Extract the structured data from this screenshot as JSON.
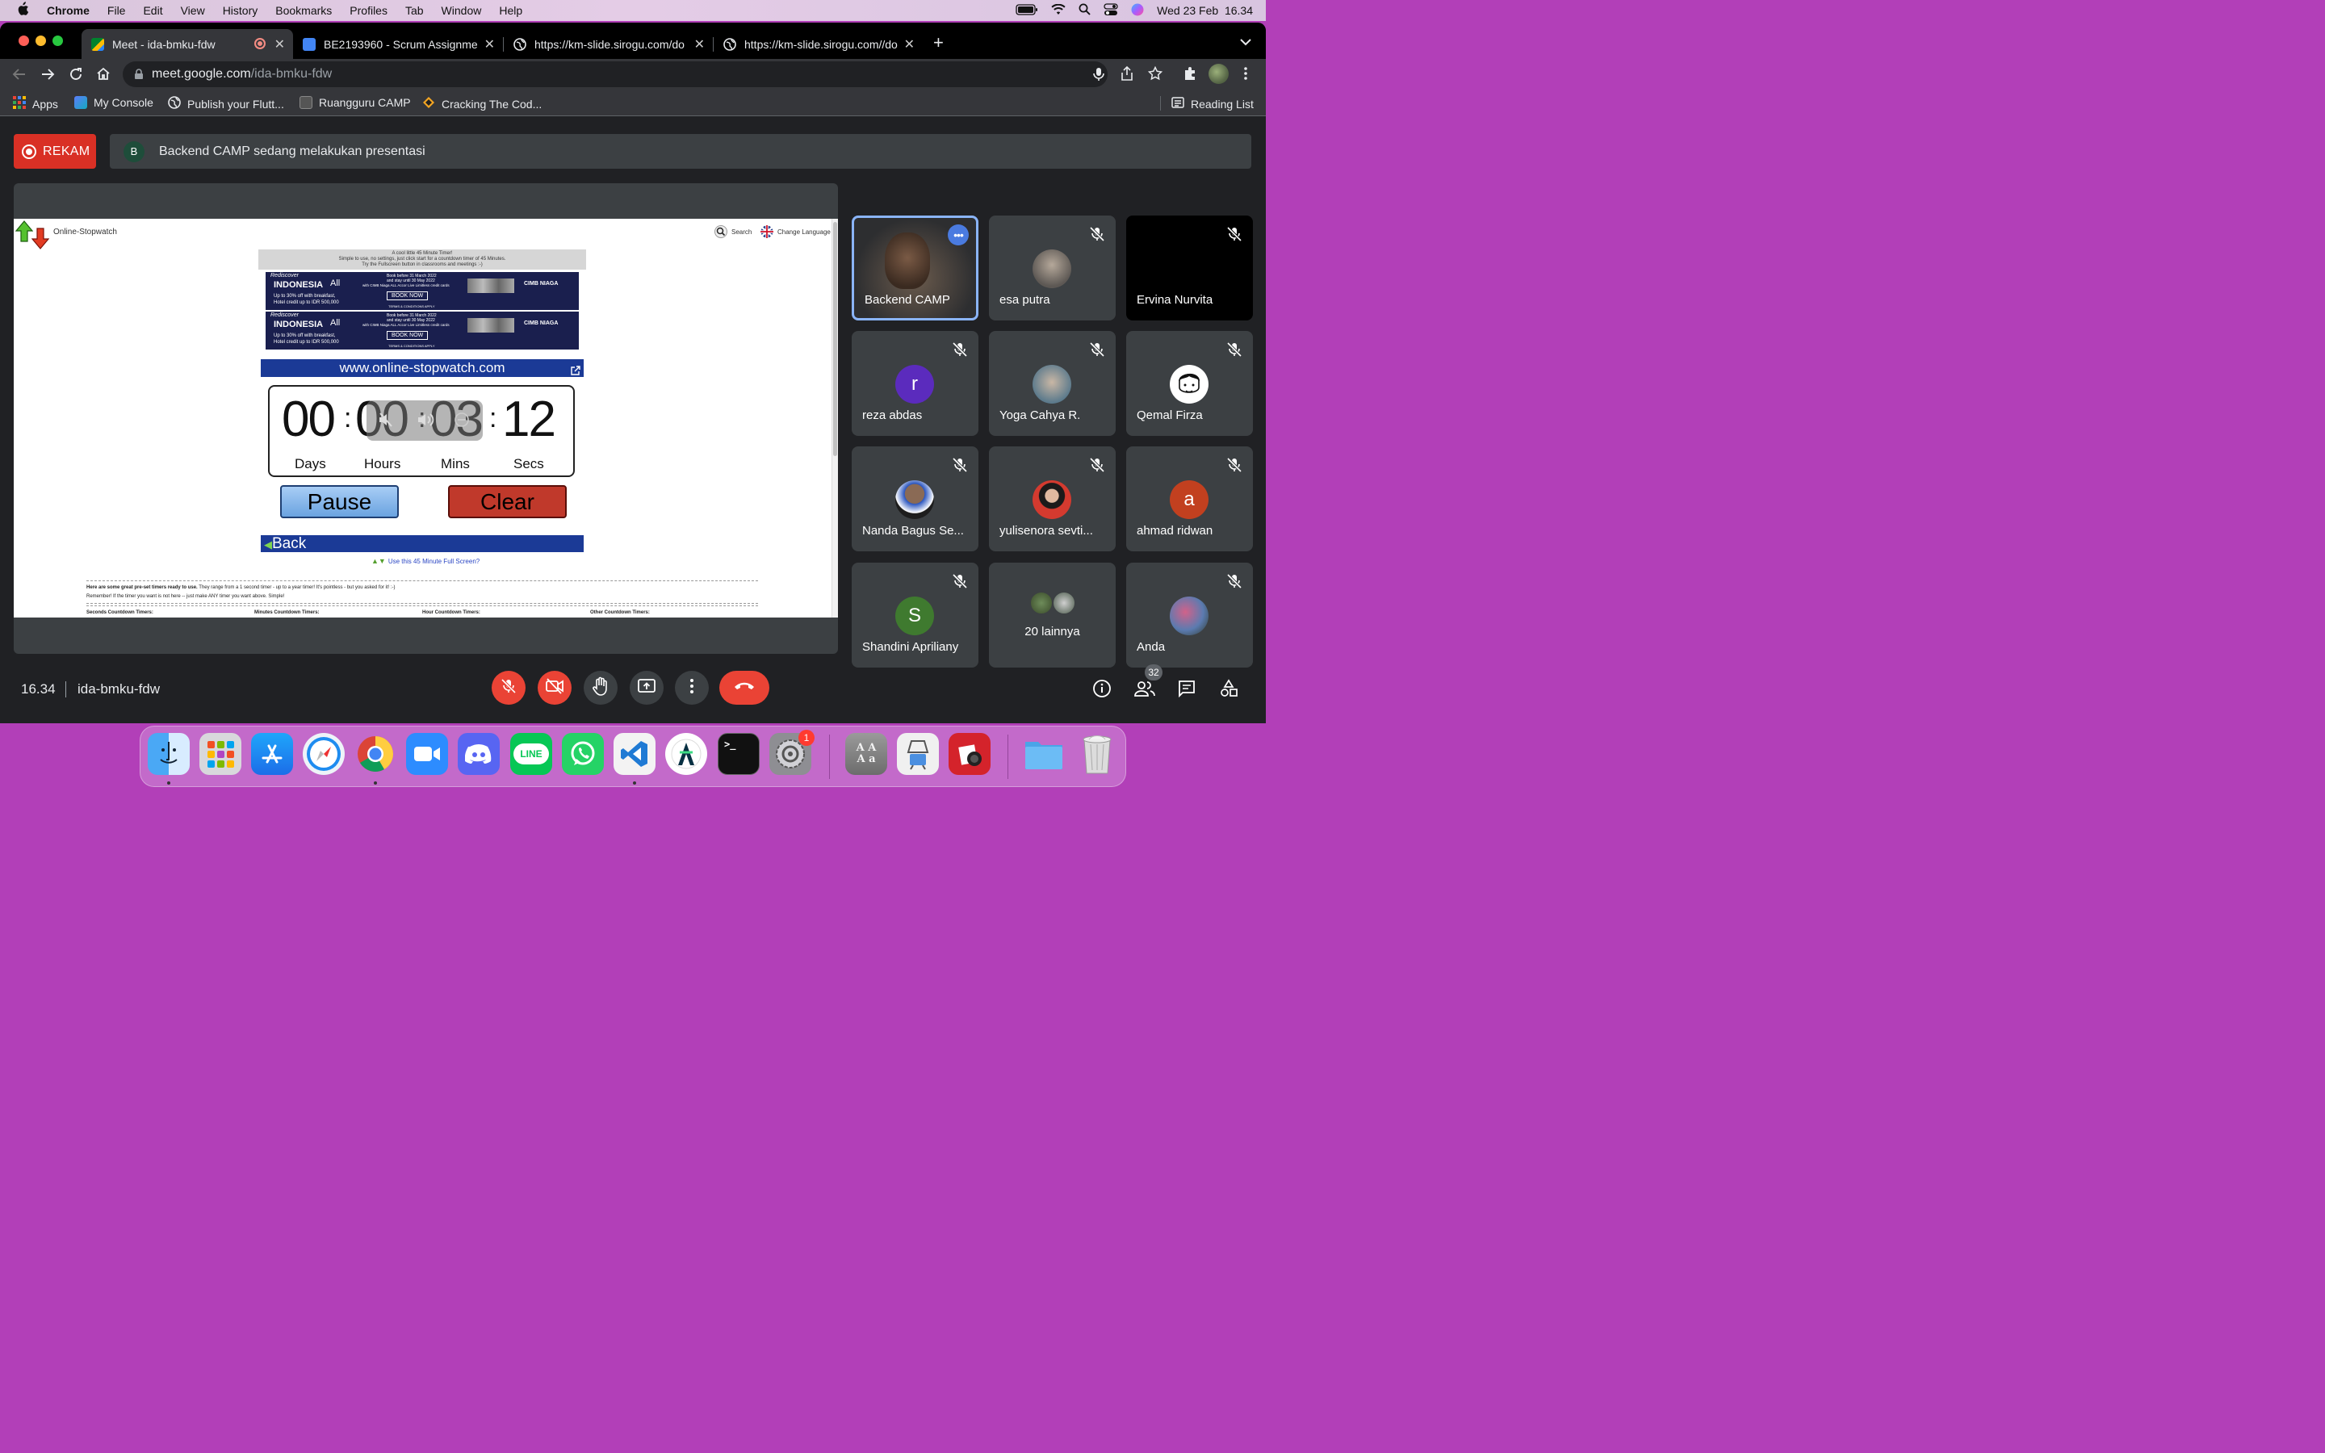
{
  "menubar": {
    "app": "Chrome",
    "items": [
      "File",
      "Edit",
      "View",
      "History",
      "Bookmarks",
      "Profiles",
      "Tab",
      "Window",
      "Help"
    ],
    "datetime": "Wed 23 Feb  16.34"
  },
  "browser": {
    "tabs": [
      {
        "title": "Meet - ida-bmku-fdw",
        "favicon": "google-meet-icon",
        "active": true
      },
      {
        "title": "BE2193960 - Scrum Assignment",
        "favicon": "google-docs-icon",
        "active": false
      },
      {
        "title": "https://km-slide.sirogu.com/do",
        "favicon": "globe-icon",
        "active": false
      },
      {
        "title": "https://km-slide.sirogu.com//do",
        "favicon": "globe-icon",
        "active": false
      }
    ],
    "url_host": "meet.google.com",
    "url_path": "/ida-bmku-fdw",
    "bookmarks": [
      {
        "label": "Apps",
        "icon": "apps-grid-icon"
      },
      {
        "label": "My Console",
        "icon": "console-icon"
      },
      {
        "label": "Publish your Flutt...",
        "icon": "globe-icon"
      },
      {
        "label": "Ruangguru CAMP",
        "icon": "ruangguru-icon"
      },
      {
        "label": "Cracking The Cod...",
        "icon": "bookmark-icon"
      }
    ],
    "reading_list": "Reading List"
  },
  "meet": {
    "record_label": "REKAM",
    "presenter_initial": "B",
    "presenting_text": "Backend CAMP sedang melakukan presentasi",
    "time": "16.34",
    "meeting_code": "ida-bmku-fdw",
    "people_count": "32",
    "participants": [
      {
        "name": "Backend CAMP",
        "kind": "video",
        "muted": false,
        "active": true
      },
      {
        "name": "esa putra",
        "kind": "photo",
        "muted": true
      },
      {
        "name": "Ervina Nurvita",
        "kind": "black",
        "muted": true
      },
      {
        "name": "reza abdas",
        "kind": "letter",
        "letter": "r",
        "color": "#5b2bbd",
        "muted": true
      },
      {
        "name": "Yoga Cahya R.",
        "kind": "photo",
        "muted": true
      },
      {
        "name": "Qemal Firza",
        "kind": "photo",
        "muted": true
      },
      {
        "name": "Nanda Bagus Se...",
        "kind": "photo",
        "muted": true
      },
      {
        "name": "yulisenora sevti...",
        "kind": "photo",
        "muted": true
      },
      {
        "name": "ahmad ridwan",
        "kind": "letter",
        "letter": "a",
        "color": "#c2401f",
        "muted": true
      },
      {
        "name": "Shandini Apriliany",
        "kind": "letter",
        "letter": "S",
        "color": "#3f7a2f",
        "muted": true
      },
      {
        "name": "20 lainnya",
        "kind": "others",
        "muted": false
      },
      {
        "name": "Anda",
        "kind": "photo",
        "muted": true
      }
    ]
  },
  "shared_page": {
    "brand": "Online-Stopwatch",
    "search": "Search",
    "change_language": "Change Language",
    "intro_line1": "A cool little 45 Minute Timer!",
    "intro_line2": "Simple to use, no settings, just click start for a countdown timer of 45 Minutes.",
    "intro_line3": "Try the Fullscreen button in classrooms and meetings :-)",
    "ad": {
      "brand_top": "Rediscover",
      "brand": "INDONESIA",
      "all": "All",
      "offer1": "Up to 30% off with breakfast,",
      "offer2": "Hotel credit up to IDR 500,000",
      "book_before": "Book before 31 March 2022",
      "stay_until": "and stay until 30 May 2022",
      "with": "with CIMB Niaga ALL Accor Live Limitless credit cards",
      "cta": "BOOK NOW",
      "terms": "TERMS & CONDITIONS APPLY",
      "bank": "CIMB NIAGA"
    },
    "site_url": "www.online-stopwatch.com",
    "timer": {
      "days": "00",
      "hours": "00",
      "mins": "03",
      "secs": "12"
    },
    "timer_labels": {
      "days": "Days",
      "hours": "Hours",
      "mins": "Mins",
      "secs": "Secs"
    },
    "pause": "Pause",
    "clear": "Clear",
    "back": "Back",
    "fullscreen_link": "Use this 45 Minute Full Screen?",
    "presets_bold": "Here are some great pre-set timers ready to use.",
    "presets_text": " They range from a 1 second timer - up to a year timer! It's pointless - but you asked for it! :-)",
    "remember": "Remember! If the timer you want is not here -- just make ANY timer you want above. Simple!",
    "col1": "Seconds Countdown Timers:",
    "col2": "Minutes Countdown Timers:",
    "col3": "Hour Countdown Timers:",
    "col4": "Other Countdown Timers:"
  },
  "dock": {
    "apps": [
      "Finder",
      "Launchpad",
      "App Store",
      "Safari",
      "Chrome",
      "Zoom",
      "Discord",
      "LINE",
      "WhatsApp",
      "VS Code",
      "Android Studio",
      "Terminal",
      "System Preferences",
      "Dictionary",
      "Preview",
      "Photo Booth",
      "Folder",
      "Trash"
    ],
    "line_label": "LINE",
    "settings_badge": "1",
    "terminal_prompt": ">_",
    "dict_glyph": "A A\nA a"
  },
  "colors": {
    "accent": "#8ab4f8",
    "record": "#d93025",
    "end_call": "#ea4335",
    "meet_bg": "#202124",
    "tile_bg": "#3c4043",
    "active_border": "#8ab4f8",
    "stopwatch_bar": "#1b3a96",
    "clear_btn": "#c0392b",
    "pause_btn": "#7fb3ea"
  }
}
